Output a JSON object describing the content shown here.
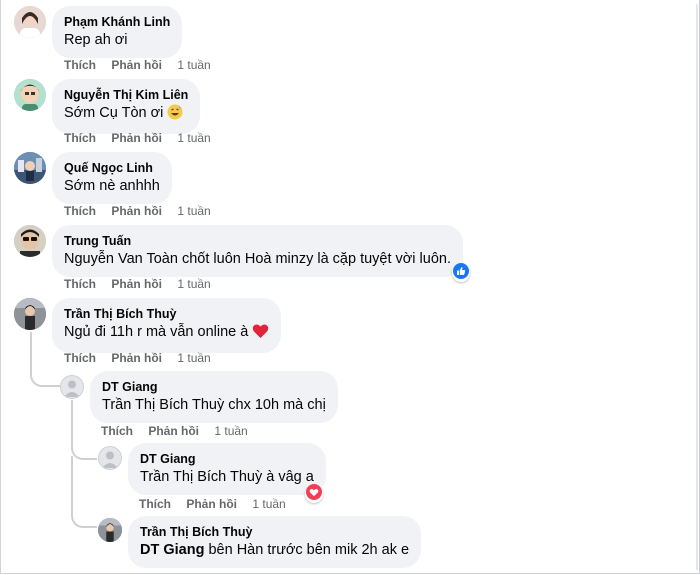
{
  "actions": {
    "like": "Thích",
    "reply": "Phản hồi"
  },
  "comments": [
    {
      "name": "Phạm Khánh Linh",
      "text": "Rep ah ơi",
      "time": "1 tuần"
    },
    {
      "name": "Nguyễn Thị Kim Liên",
      "text": "Sớm Cụ Tòn ơi",
      "time": "1 tuần",
      "emoji": "grinning-sweat-emoji"
    },
    {
      "name": "Quế Ngọc Linh",
      "text": "Sớm nè anhhh",
      "time": "1 tuần"
    },
    {
      "name": "Trung Tuấn",
      "text": "Nguyễn Van Toàn chốt luôn Hoà minzy là cặp tuyệt vời luôn.",
      "time": "1 tuần",
      "reaction": "like-icon"
    },
    {
      "name": "Trần Thị Bích Thuỳ",
      "text": "Ngủ đi 11h r mà vẫn online à",
      "time": "1 tuần",
      "emoji": "red-heart-emoji"
    }
  ],
  "replies": [
    {
      "name": "DT Giang",
      "mention": "Trần Thị Bích Thuỳ",
      "text": " chx 10h mà chị",
      "time": "1 tuần"
    },
    {
      "name": "DT Giang",
      "mention": "Trần Thị Bích Thuỳ",
      "text": " à vâg a",
      "time": "1 tuần",
      "reaction": "love-icon"
    },
    {
      "name": "Trần Thị Bích Thuỳ",
      "mention": "DT Giang",
      "text": " bên Hàn trước bên mik 2h ak e"
    }
  ],
  "colors": {
    "bubble": "#f0f2f5",
    "meta": "#65676b",
    "like_blue": "#1877f2",
    "love_red": "#f33e58"
  }
}
